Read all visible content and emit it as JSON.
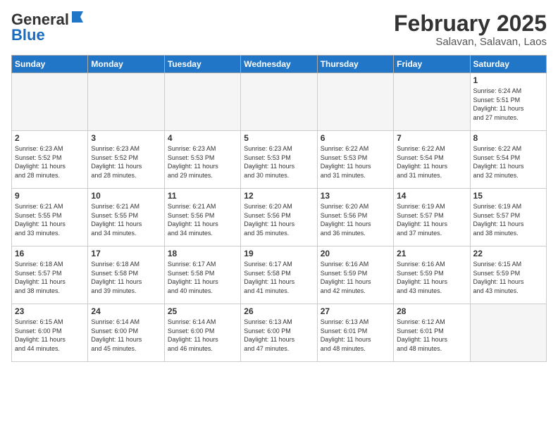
{
  "header": {
    "logo_general": "General",
    "logo_blue": "Blue",
    "month_year": "February 2025",
    "location": "Salavan, Salavan, Laos"
  },
  "weekdays": [
    "Sunday",
    "Monday",
    "Tuesday",
    "Wednesday",
    "Thursday",
    "Friday",
    "Saturday"
  ],
  "weeks": [
    [
      {
        "num": "",
        "info": ""
      },
      {
        "num": "",
        "info": ""
      },
      {
        "num": "",
        "info": ""
      },
      {
        "num": "",
        "info": ""
      },
      {
        "num": "",
        "info": ""
      },
      {
        "num": "",
        "info": ""
      },
      {
        "num": "1",
        "info": "Sunrise: 6:24 AM\nSunset: 5:51 PM\nDaylight: 11 hours\nand 27 minutes."
      }
    ],
    [
      {
        "num": "2",
        "info": "Sunrise: 6:23 AM\nSunset: 5:52 PM\nDaylight: 11 hours\nand 28 minutes."
      },
      {
        "num": "3",
        "info": "Sunrise: 6:23 AM\nSunset: 5:52 PM\nDaylight: 11 hours\nand 28 minutes."
      },
      {
        "num": "4",
        "info": "Sunrise: 6:23 AM\nSunset: 5:53 PM\nDaylight: 11 hours\nand 29 minutes."
      },
      {
        "num": "5",
        "info": "Sunrise: 6:23 AM\nSunset: 5:53 PM\nDaylight: 11 hours\nand 30 minutes."
      },
      {
        "num": "6",
        "info": "Sunrise: 6:22 AM\nSunset: 5:53 PM\nDaylight: 11 hours\nand 31 minutes."
      },
      {
        "num": "7",
        "info": "Sunrise: 6:22 AM\nSunset: 5:54 PM\nDaylight: 11 hours\nand 31 minutes."
      },
      {
        "num": "8",
        "info": "Sunrise: 6:22 AM\nSunset: 5:54 PM\nDaylight: 11 hours\nand 32 minutes."
      }
    ],
    [
      {
        "num": "9",
        "info": "Sunrise: 6:21 AM\nSunset: 5:55 PM\nDaylight: 11 hours\nand 33 minutes."
      },
      {
        "num": "10",
        "info": "Sunrise: 6:21 AM\nSunset: 5:55 PM\nDaylight: 11 hours\nand 34 minutes."
      },
      {
        "num": "11",
        "info": "Sunrise: 6:21 AM\nSunset: 5:56 PM\nDaylight: 11 hours\nand 34 minutes."
      },
      {
        "num": "12",
        "info": "Sunrise: 6:20 AM\nSunset: 5:56 PM\nDaylight: 11 hours\nand 35 minutes."
      },
      {
        "num": "13",
        "info": "Sunrise: 6:20 AM\nSunset: 5:56 PM\nDaylight: 11 hours\nand 36 minutes."
      },
      {
        "num": "14",
        "info": "Sunrise: 6:19 AM\nSunset: 5:57 PM\nDaylight: 11 hours\nand 37 minutes."
      },
      {
        "num": "15",
        "info": "Sunrise: 6:19 AM\nSunset: 5:57 PM\nDaylight: 11 hours\nand 38 minutes."
      }
    ],
    [
      {
        "num": "16",
        "info": "Sunrise: 6:18 AM\nSunset: 5:57 PM\nDaylight: 11 hours\nand 38 minutes."
      },
      {
        "num": "17",
        "info": "Sunrise: 6:18 AM\nSunset: 5:58 PM\nDaylight: 11 hours\nand 39 minutes."
      },
      {
        "num": "18",
        "info": "Sunrise: 6:17 AM\nSunset: 5:58 PM\nDaylight: 11 hours\nand 40 minutes."
      },
      {
        "num": "19",
        "info": "Sunrise: 6:17 AM\nSunset: 5:58 PM\nDaylight: 11 hours\nand 41 minutes."
      },
      {
        "num": "20",
        "info": "Sunrise: 6:16 AM\nSunset: 5:59 PM\nDaylight: 11 hours\nand 42 minutes."
      },
      {
        "num": "21",
        "info": "Sunrise: 6:16 AM\nSunset: 5:59 PM\nDaylight: 11 hours\nand 43 minutes."
      },
      {
        "num": "22",
        "info": "Sunrise: 6:15 AM\nSunset: 5:59 PM\nDaylight: 11 hours\nand 43 minutes."
      }
    ],
    [
      {
        "num": "23",
        "info": "Sunrise: 6:15 AM\nSunset: 6:00 PM\nDaylight: 11 hours\nand 44 minutes."
      },
      {
        "num": "24",
        "info": "Sunrise: 6:14 AM\nSunset: 6:00 PM\nDaylight: 11 hours\nand 45 minutes."
      },
      {
        "num": "25",
        "info": "Sunrise: 6:14 AM\nSunset: 6:00 PM\nDaylight: 11 hours\nand 46 minutes."
      },
      {
        "num": "26",
        "info": "Sunrise: 6:13 AM\nSunset: 6:00 PM\nDaylight: 11 hours\nand 47 minutes."
      },
      {
        "num": "27",
        "info": "Sunrise: 6:13 AM\nSunset: 6:01 PM\nDaylight: 11 hours\nand 48 minutes."
      },
      {
        "num": "28",
        "info": "Sunrise: 6:12 AM\nSunset: 6:01 PM\nDaylight: 11 hours\nand 48 minutes."
      },
      {
        "num": "",
        "info": ""
      }
    ]
  ]
}
